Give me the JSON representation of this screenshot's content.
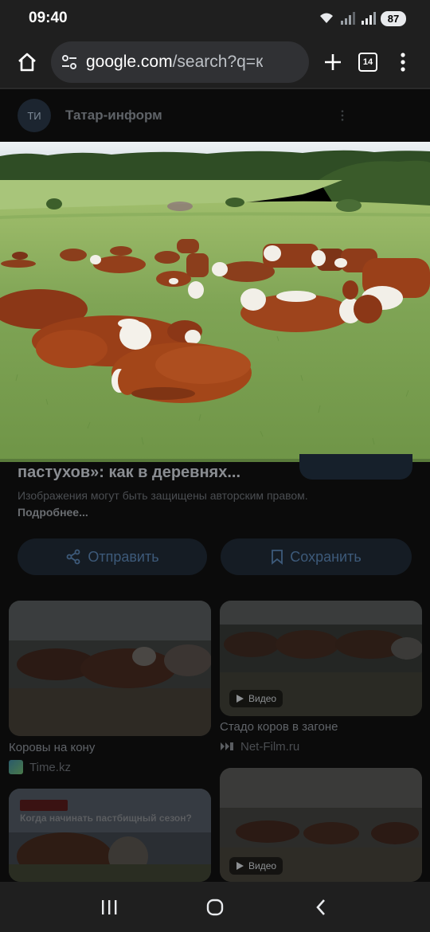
{
  "status": {
    "time": "09:40",
    "battery": "87"
  },
  "browser": {
    "url_domain": "google.com",
    "url_path": "/search?q=к",
    "tab_count": "14"
  },
  "source": {
    "logo_text": "ТИ",
    "name": "Татар-информ"
  },
  "detail": {
    "title": "пастухов»: как в деревнях...",
    "copyright_text": "Изображения могут быть защищены авторским правом.",
    "copyright_link": "Подробнее...",
    "share_label": "Отправить",
    "save_label": "Сохранить"
  },
  "related": [
    {
      "caption": "Коровы на кону",
      "source": "Time.kz",
      "video": false
    },
    {
      "caption": "Стадо коров в загоне",
      "source": "Net-Film.ru",
      "video": true,
      "video_label": "Видео"
    },
    {
      "overlay_title": "Когда начинать пастбищный сезон?",
      "video": false
    },
    {
      "video": true,
      "video_label": "Видео"
    }
  ],
  "colors": {
    "accent_blue": "#3d5a7a",
    "statusbar_bg": "#1f1f1f"
  }
}
